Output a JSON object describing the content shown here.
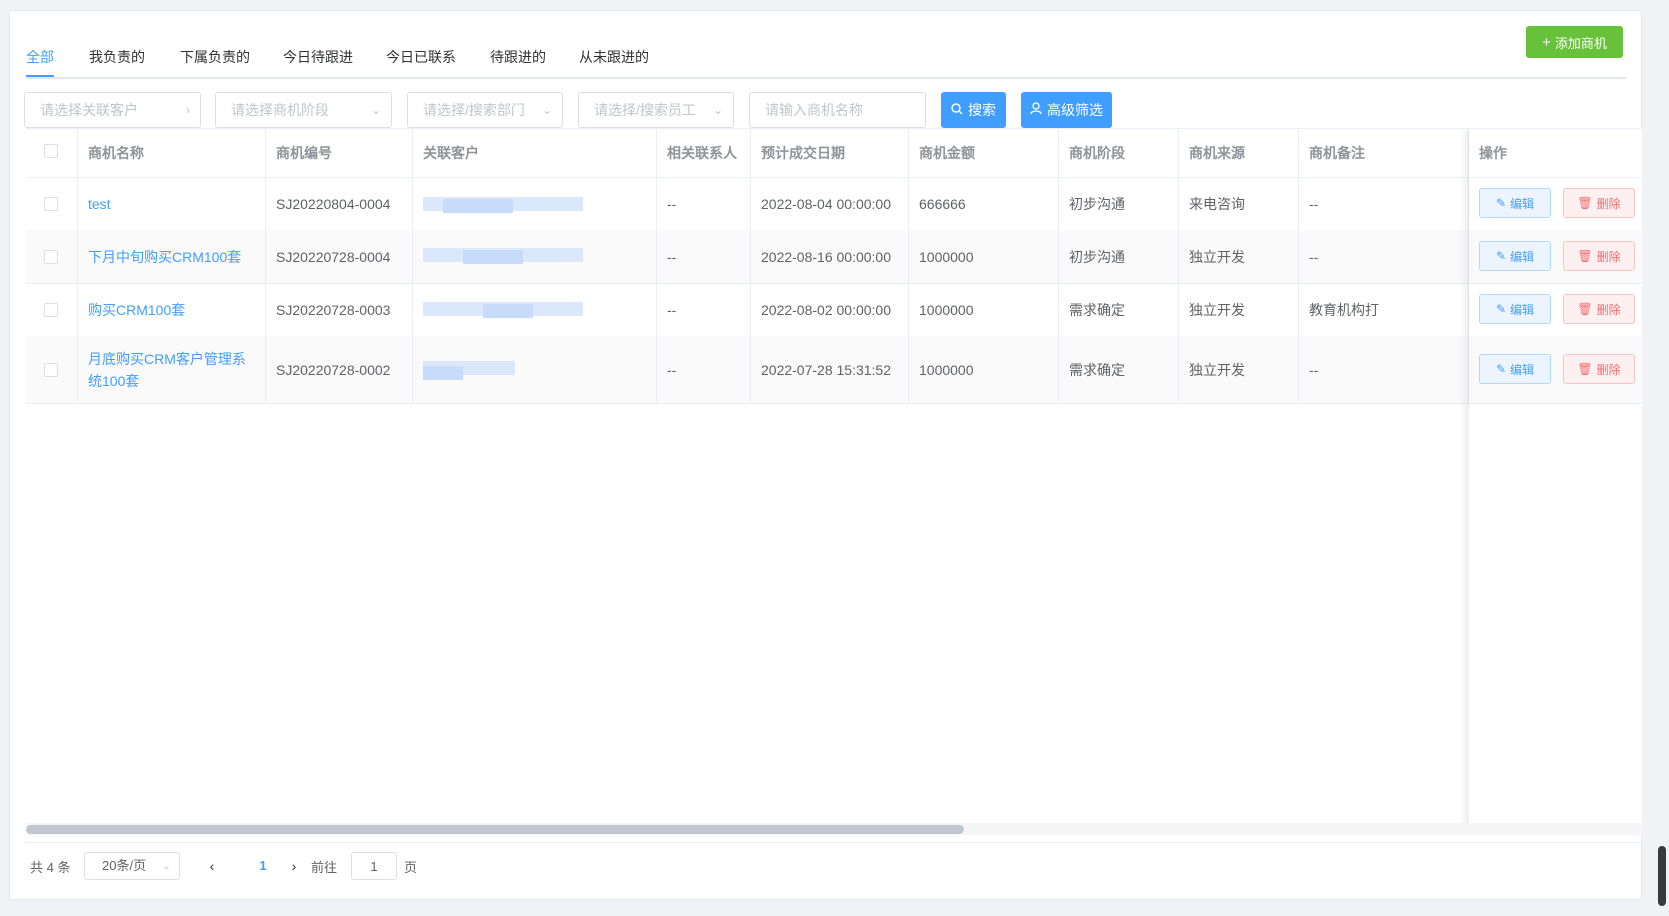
{
  "tabs": [
    "全部",
    "我负责的",
    "下属负责的",
    "今日待跟进",
    "今日已联系",
    "待跟进的",
    "从未跟进的"
  ],
  "add_button": {
    "icon": "plus-icon",
    "label": "添加商机"
  },
  "filters": {
    "customer": "请选择关联客户",
    "stage": "请选择商机阶段",
    "department": "请选择/搜索部门",
    "employee": "请选择/搜索员工",
    "name": "请输入商机名称"
  },
  "search_button": "搜索",
  "advanced_button": "高级筛选",
  "table": {
    "columns": [
      "商机名称",
      "商机编号",
      "关联客户",
      "相关联系人",
      "预计成交日期",
      "商机金额",
      "商机阶段",
      "商机来源",
      "商机备注",
      "操作"
    ],
    "rows": [
      {
        "name": "test",
        "code": "SJ20220804-0004",
        "contact": "--",
        "date": "2022-08-04 00:00:00",
        "amount": "666666",
        "stage": "初步沟通",
        "source": "来电咨询",
        "remark": "--"
      },
      {
        "name": "下月中旬购买CRM100套",
        "code": "SJ20220728-0004",
        "contact": "--",
        "date": "2022-08-16 00:00:00",
        "amount": "1000000",
        "stage": "初步沟通",
        "source": "独立开发",
        "remark": "--"
      },
      {
        "name": "购买CRM100套",
        "code": "SJ20220728-0003",
        "contact": "--",
        "date": "2022-08-02 00:00:00",
        "amount": "1000000",
        "stage": "需求确定",
        "source": "独立开发",
        "remark": "教育机构打"
      },
      {
        "name": "月底购买CRM客户管理系统100套",
        "code": "SJ20220728-0002",
        "contact": "--",
        "date": "2022-07-28 15:31:52",
        "amount": "1000000",
        "stage": "需求确定",
        "source": "独立开发",
        "remark": "--"
      }
    ],
    "edit_label": "编辑",
    "delete_label": "删除"
  },
  "pagination": {
    "total": "共 4 条",
    "page_size": "20条/页",
    "current": "1",
    "goto_label": "前往",
    "goto_value": "1",
    "page_suffix": "页"
  },
  "colors": {
    "primary": "#409eff",
    "success": "#67c23a",
    "danger": "#f56c6c"
  }
}
